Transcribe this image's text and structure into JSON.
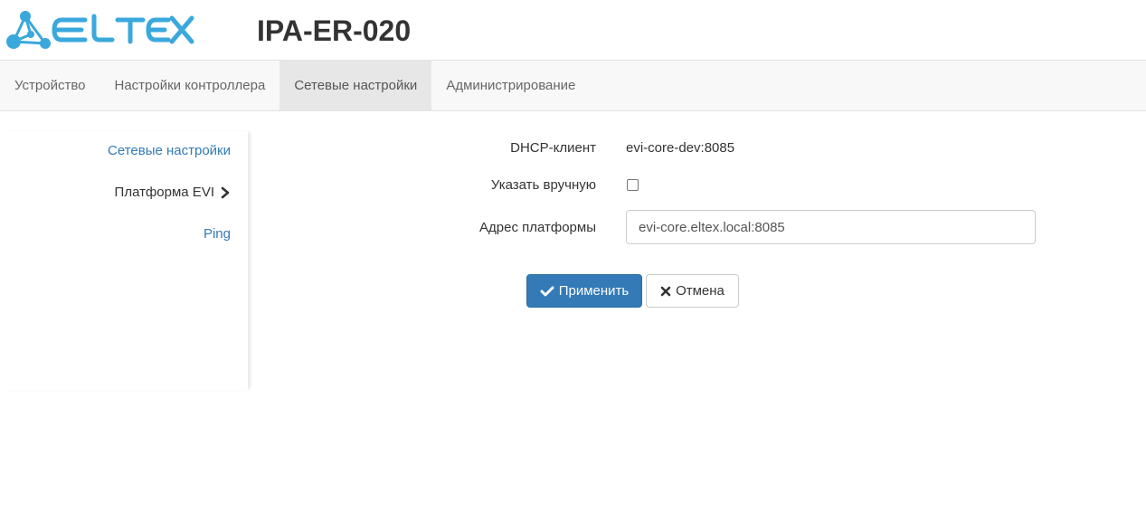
{
  "header": {
    "logo_text": "ELTEX",
    "device_title": "IPA-ER-020"
  },
  "nav": {
    "tabs": [
      {
        "label": "Устройство",
        "active": false
      },
      {
        "label": "Настройки контроллера",
        "active": false
      },
      {
        "label": "Сетевые настройки",
        "active": true
      },
      {
        "label": "Администрирование",
        "active": false
      }
    ]
  },
  "sidebar": {
    "items": [
      {
        "label": "Сетевые настройки"
      },
      {
        "label": "Платформа EVI",
        "icon": "chevron-right-icon"
      },
      {
        "label": "Ping"
      }
    ]
  },
  "form": {
    "dhcp_label": "DHCP-клиент",
    "dhcp_value": "evi-core-dev:8085",
    "manual_label": "Указать вручную",
    "manual_checked": false,
    "address_label": "Адрес платформы",
    "address_value": "evi-core.eltex.local:8085"
  },
  "actions": {
    "apply_label": "Применить",
    "apply_icon": "check-icon",
    "cancel_label": "Отмена",
    "cancel_icon": "close-icon"
  },
  "colors": {
    "brand_blue": "#3aa8dc",
    "primary": "#337ab7",
    "link": "#337ab7"
  }
}
